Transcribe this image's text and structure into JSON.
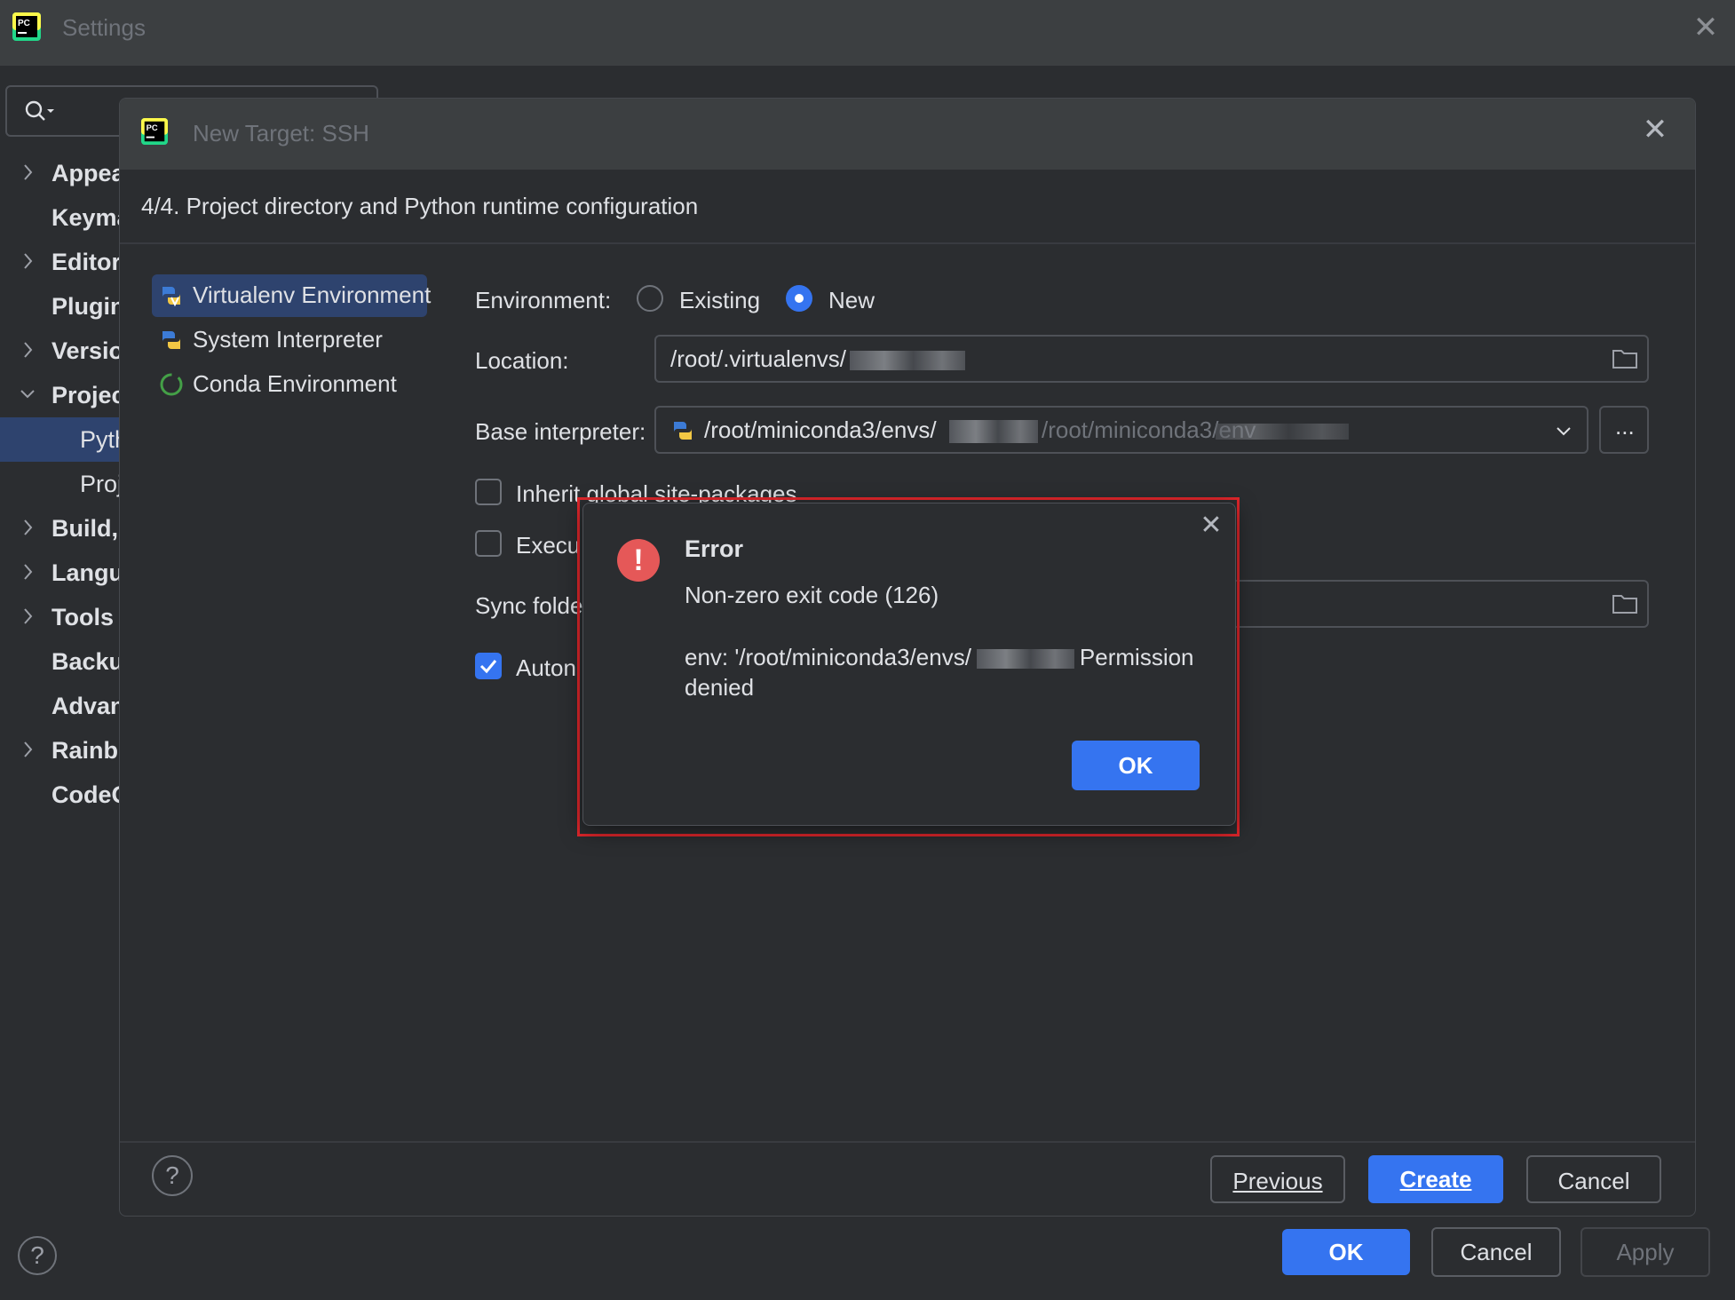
{
  "settings": {
    "title": "Settings",
    "tree": [
      {
        "label": "Appearance & Behavior",
        "expandable": true
      },
      {
        "label": "Keymap",
        "expandable": false
      },
      {
        "label": "Editor",
        "expandable": true
      },
      {
        "label": "Plugins",
        "expandable": false
      },
      {
        "label": "Version Control",
        "expandable": true
      },
      {
        "label": "Project",
        "expandable": true,
        "expanded": true
      },
      {
        "label": "Python Interpreter",
        "sub": true,
        "selected": true
      },
      {
        "label": "Project Structure",
        "sub": true
      },
      {
        "label": "Build, Execution, Deployment",
        "expandable": true
      },
      {
        "label": "Languages & Frameworks",
        "expandable": true
      },
      {
        "label": "Tools",
        "expandable": true
      },
      {
        "label": "Backup and Sync",
        "expandable": false
      },
      {
        "label": "Advanced Settings",
        "expandable": false
      },
      {
        "label": "Rainbow",
        "expandable": true
      },
      {
        "label": "CodeGeeX",
        "expandable": false
      }
    ],
    "help_label": "?",
    "ok_label": "OK",
    "cancel_label": "Cancel",
    "apply_label": "Apply"
  },
  "new_target": {
    "title": "New Target: SSH",
    "step": "4/4. Project directory and Python runtime configuration",
    "env_types": [
      "Virtualenv Environment",
      "System Interpreter",
      "Conda Environment"
    ],
    "environment_label": "Environment:",
    "radio_existing": "Existing",
    "radio_new": "New",
    "location_label": "Location:",
    "location_value": "/root/.virtualenvs/",
    "base_interpreter_label": "Base interpreter:",
    "base_interpreter_value": "/root/miniconda3/envs/",
    "base_interpreter_hint": "/root/miniconda3/env",
    "browse_label": "...",
    "inherit_label": "Inherit global site-packages",
    "execute_label": "Execu",
    "sync_label": "Sync folde",
    "auto_label": "Auton",
    "help_label": "?",
    "previous_label": "Previous",
    "create_label": "Create",
    "cancel_label": "Cancel"
  },
  "error": {
    "title": "Error",
    "line1": "Non-zero exit code (126)",
    "line2_prefix": "env: '/root/miniconda3/envs/",
    "line2_suffix": "Permission denied",
    "ok_label": "OK"
  },
  "colors": {
    "accent": "#3574f0",
    "error_icon": "#e55858",
    "highlight": "#e0262b",
    "selection": "#2e436e"
  }
}
